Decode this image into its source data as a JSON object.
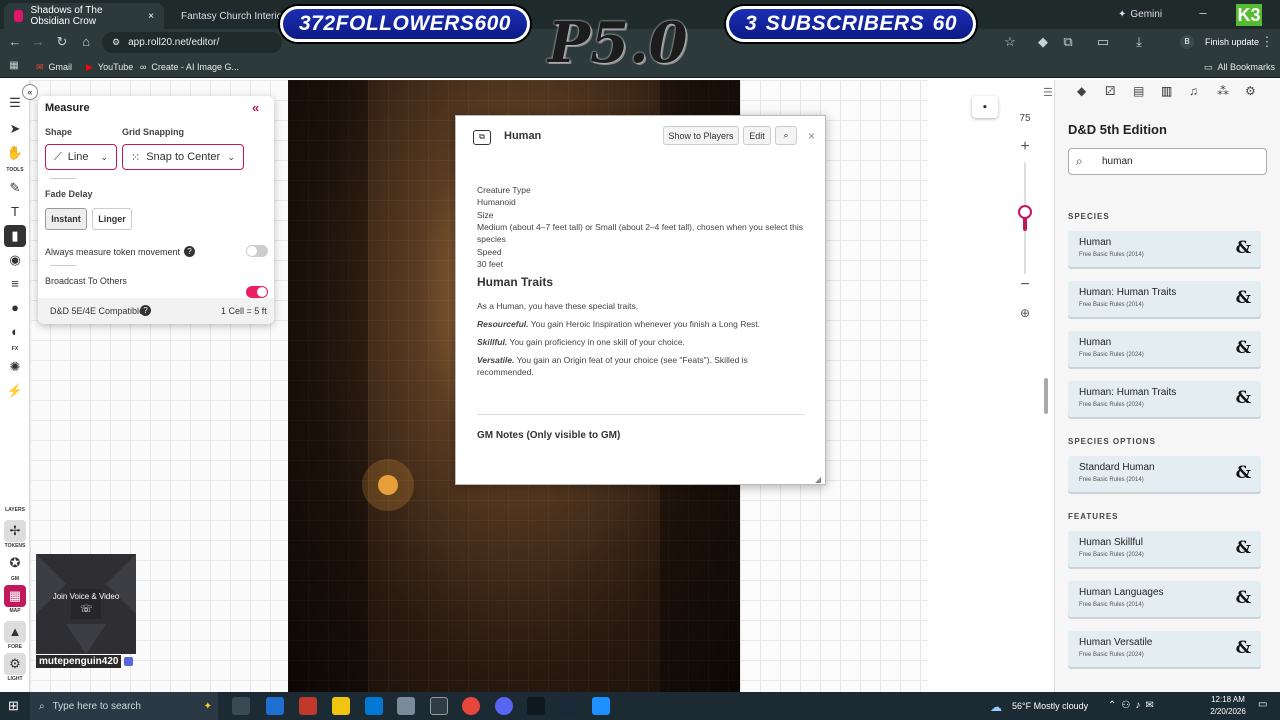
{
  "browser": {
    "tabs": [
      {
        "label": "Shadows of The Obsidian Crow",
        "active": true,
        "close": "×"
      },
      {
        "label": "Fantasy Church Interior De",
        "active": false
      }
    ],
    "url": "app.roll20.net/editor/",
    "gemini": "Gemini",
    "finish_update": "Finish update",
    "profile_initial": "B",
    "bookmarks": [
      "Gmail",
      "YouTube",
      "Create - AI Image G..."
    ],
    "all_bookmarks": "All Bookmarks"
  },
  "overlay": {
    "followers": {
      "count": "372",
      "label": "FOLLOWERS",
      "goal": "600"
    },
    "subscribers": {
      "count": "3",
      "label": "SUBSCRIBERS",
      "goal": "60"
    },
    "logo": "P5.0",
    "corner": "K3"
  },
  "left_rail": {
    "labels": {
      "tools": "TOOLS",
      "fx": "FX",
      "layers": "LAYERS",
      "tokens": "TOKENS",
      "gm": "GM",
      "map": "MAP",
      "fore": "FORE",
      "light": "LIGHT"
    }
  },
  "measure": {
    "title": "Measure",
    "shape_label": "Shape",
    "grid_label": "Grid Snapping",
    "shape_value": "Line",
    "grid_value": "Snap to Center",
    "fade_label": "Fade Delay",
    "instant": "Instant",
    "linger": "Linger",
    "always_measure": "Always measure token movement",
    "always_measure_on": false,
    "broadcast": "Broadcast To Others",
    "broadcast_on": true,
    "compat": "D&D 5E/4E Compatible",
    "cell": "1 Cell = 5 ft",
    "accent": "#e91e63"
  },
  "dialog": {
    "title": "Human",
    "show_players": "Show to Players",
    "edit": "Edit",
    "close": "×",
    "lines": [
      "Creature Type",
      "Humanoid",
      "Size",
      "Medium (about 4–7 feet tall) or Small (about 2–4 feet tall), chosen when you select this",
      "species",
      "Speed",
      "30 feet"
    ],
    "traits_heading": "Human Traits",
    "traits_intro": "As a Human, you have these special traits.",
    "traits": [
      {
        "name": "Resourceful.",
        "text": " You gain Heroic Inspiration whenever you finish a Long Rest."
      },
      {
        "name": "Skillful.",
        "text": " You gain proficiency in one skill of your choice."
      },
      {
        "name": "Versatile.",
        "text": " You gain an Origin feat of your choice (see \"Feats\"). Skilled is"
      }
    ],
    "versatile_cont": "recommended.",
    "gm_notes": "GM Notes (Only visible to GM)"
  },
  "zoom": {
    "value": "75",
    "plus": "+",
    "minus": "−",
    "level": 0.55
  },
  "compendium": {
    "title": "D&D 5th Edition",
    "search_value": "human",
    "sections": [
      {
        "label": "SPECIES",
        "items": [
          {
            "title": "Human",
            "sub": "Free Basic Rules (2014)"
          },
          {
            "title": "Human: Human Traits",
            "sub": "Free Basic Rules (2014)"
          },
          {
            "title": "Human",
            "sub": "Free Basic Rules (2024)"
          },
          {
            "title": "Human: Human Traits",
            "sub": "Free Basic Rules (2024)"
          }
        ]
      },
      {
        "label": "SPECIES OPTIONS",
        "items": [
          {
            "title": "Standard Human",
            "sub": "Free Basic Rules (2014)"
          }
        ]
      },
      {
        "label": "FEATURES",
        "items": [
          {
            "title": "Human Skillful",
            "sub": "Free Basic Rules (2024)"
          },
          {
            "title": "Human Languages",
            "sub": "Free Basic Rules (2014)"
          },
          {
            "title": "Human Versatile",
            "sub": "Free Basic Rules (2024)"
          }
        ]
      }
    ],
    "amp": "&"
  },
  "video": {
    "join": "Join Voice & Video",
    "username": "mutepenguin420"
  },
  "taskbar": {
    "search_placeholder": "Type here to search",
    "weather": "56°F  Mostly cloudy",
    "time": "12:18 AM",
    "date": "2/20/2026"
  }
}
